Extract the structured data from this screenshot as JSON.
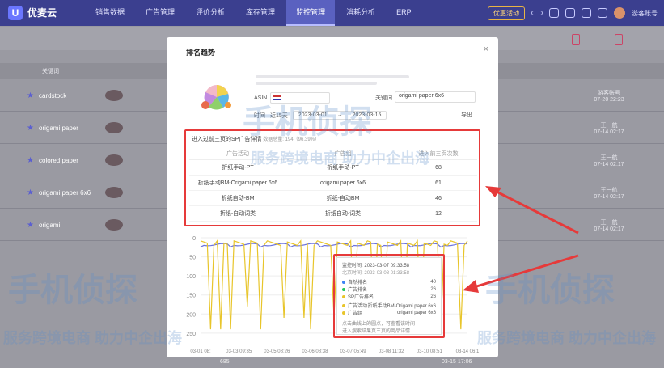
{
  "nav": {
    "brand": "优麦云",
    "brand_sub": "",
    "items": [
      "销售数据",
      "广告管理",
      "评价分析",
      "库存管理",
      "监控管理",
      "消耗分析",
      "ERP"
    ],
    "active_index": 4,
    "pill_1": "优惠活动",
    "pill_2": "",
    "user": "游客账号"
  },
  "background_page": {
    "header_col": "关键词",
    "rows": [
      {
        "keyword": "cardstock",
        "owner": "游客账号",
        "date": "07-20 22:23"
      },
      {
        "keyword": "origami paper",
        "owner": "王一航",
        "date": "07-14 02:17"
      },
      {
        "keyword": "colored paper",
        "owner": "王一航",
        "date": "07-14 02:17"
      },
      {
        "keyword": "origami paper 6x6",
        "owner": "王一航",
        "date": "07-14 02:17"
      },
      {
        "keyword": "origami",
        "owner": "王一航",
        "date": "07-14 02:17"
      }
    ],
    "btn_1": "",
    "btn_2": "",
    "bottom_value": "685",
    "bottom_date": "03-15 17:06"
  },
  "modal": {
    "title": "排名趋势",
    "close": "×",
    "asin_label": "ASIN",
    "keyword_label": "关键词",
    "keyword_value": "origami paper 6x6",
    "time_label": "时间",
    "time_range": "近15天",
    "date_start": "2023-03-01",
    "date_sep": "→",
    "date_end": "2023-03-15",
    "export": "导出",
    "sp_title": "进入过前三页的SP广告详情",
    "sp_sub": "数据总量: 194（96.39%）",
    "sp_headers": [
      "广告活动",
      "广告组",
      "进入前三页次数"
    ],
    "sp_rows": [
      {
        "campaign": "折纸手动-PT",
        "group": "折纸手动-PT",
        "count": "68"
      },
      {
        "campaign": "折纸手动BM-Origami paper 6x6",
        "group": "origami paper 6x6",
        "count": "61"
      },
      {
        "campaign": "折纸自动-BM",
        "group": "折纸-自动BM",
        "count": "46"
      },
      {
        "campaign": "折纸-自动词类",
        "group": "折纸自动-词类",
        "count": "12"
      }
    ]
  },
  "chart_data": {
    "type": "line",
    "x": [
      "03-01 08:",
      "03-03 09:35",
      "03-05 08:26",
      "03-06 08:38",
      "03-07 05:49",
      "03-08 11:32",
      "03-10 08:51",
      "03-14 06:1"
    ],
    "y_ticks": [
      0,
      50,
      100,
      150,
      200,
      250
    ],
    "ylim": [
      0,
      280
    ],
    "y_inverted": true,
    "series": [
      {
        "name": "自然排名",
        "color": "#6b73e0"
      },
      {
        "name": "广告排名",
        "color": "#e8c52a"
      }
    ],
    "tooltip": {
      "monitor_time_label": "监控时间",
      "monitor_time": "2023-03-07 09:33:58",
      "local_time_label": "北京时间",
      "local_time": "2023-03-08 01:33:58",
      "lines": [
        {
          "label": "自然排名",
          "value": "40",
          "color": "#3b82f6"
        },
        {
          "label": "广告排名",
          "value": "26",
          "color": "#22c55e"
        },
        {
          "label": "SP广告排名",
          "value": "26",
          "color": "#e8c52a"
        }
      ],
      "ad_lines": [
        {
          "label": "广告活动",
          "value": "折纸手动BM-Origami paper 6x6"
        },
        {
          "label": "广告组",
          "value": "origami paper 6x6"
        }
      ],
      "note_1": "点击曲线上的圆点，可查看该时间",
      "note_2": "进入搜索结果页三页的商品详情"
    }
  },
  "watermark": {
    "brand": "手机侦探",
    "slogan": "服务跨境电商 助力中企出海"
  }
}
